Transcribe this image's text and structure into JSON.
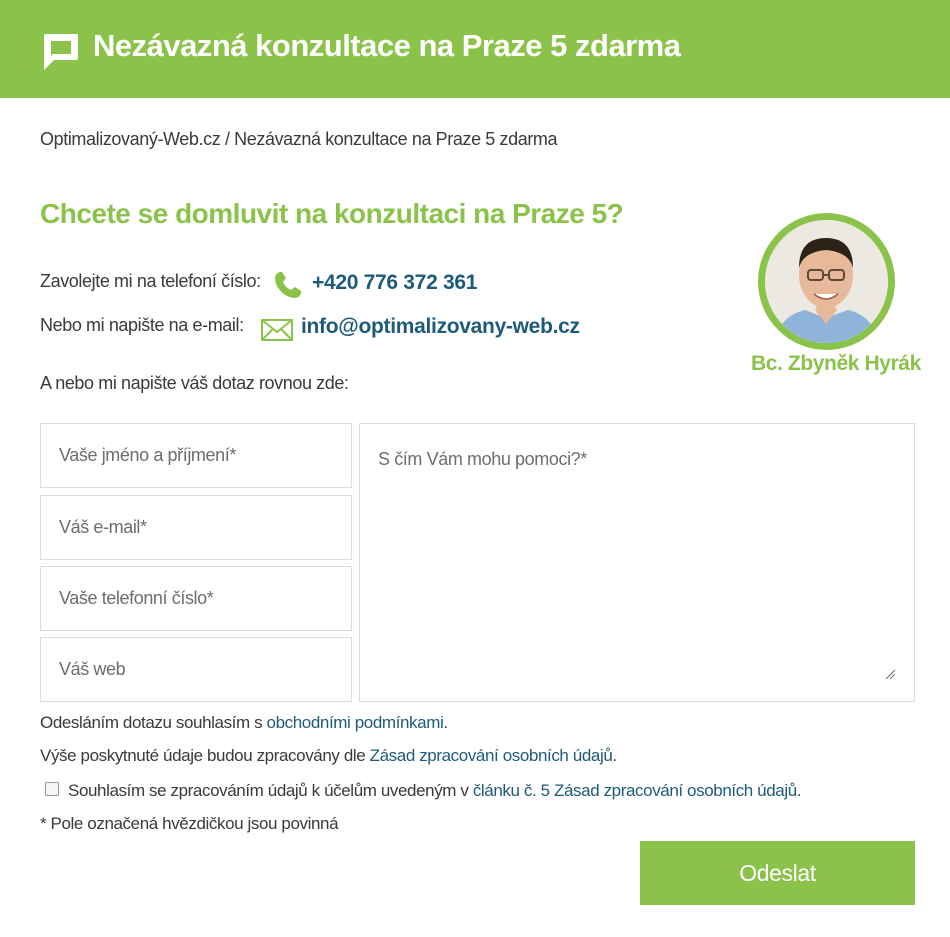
{
  "header": {
    "icon": "chat-bubble-icon",
    "title": "Nezávazná konzultace na Praze 5 zdarma"
  },
  "breadcrumb": {
    "home": "Optimalizovaný-Web.cz",
    "separator": "/",
    "current": "Nezávazná konzultace na Praze 5 zdarma"
  },
  "main": {
    "heading": "Chcete se domluvit na konzultaci na Praze 5?",
    "phone_label": "Zavolejte mi na telefoní číslo:",
    "phone_icon": "phone-icon",
    "phone_value": "+420 776 372 361",
    "email_label": "Nebo mi napište na e-mail:",
    "email_icon": "envelope-icon",
    "email_value": "info@optimalizovany-web.cz",
    "intro": "A nebo mi napište váš dotaz rovnou zde:"
  },
  "profile": {
    "name": "Bc. Zbyněk Hyrák"
  },
  "form": {
    "name_placeholder": "Vaše jméno a příjmení*",
    "email_placeholder": "Váš e-mail*",
    "phone_placeholder": "Vaše telefonní číslo*",
    "web_placeholder": "Váš web",
    "message_placeholder": "S čím Vám mohu pomoci?*",
    "consent_text_1": "Odesláním dotazu souhlasím s ",
    "consent_link_1": "obchodními podmínkami",
    "consent_text_1_end": ".",
    "data_text": "Výše poskytnuté údaje budou zpracovány dle ",
    "data_link": "Zásad zpracování osobních údajů",
    "data_text_end": ".",
    "checkbox_text": "Souhlasím se zpracováním údajů k účelům uvedeným v ",
    "checkbox_link": "článku č. 5 Zásad zpracování osobních údajů",
    "checkbox_text_end": ".",
    "checkbox_checked": false,
    "required_note": "* Pole označená hvězdičkou jsou povinná",
    "submit_label": "Odeslat"
  },
  "colors": {
    "brand_green": "#8bc34a",
    "link_blue": "#1e5b7a"
  }
}
